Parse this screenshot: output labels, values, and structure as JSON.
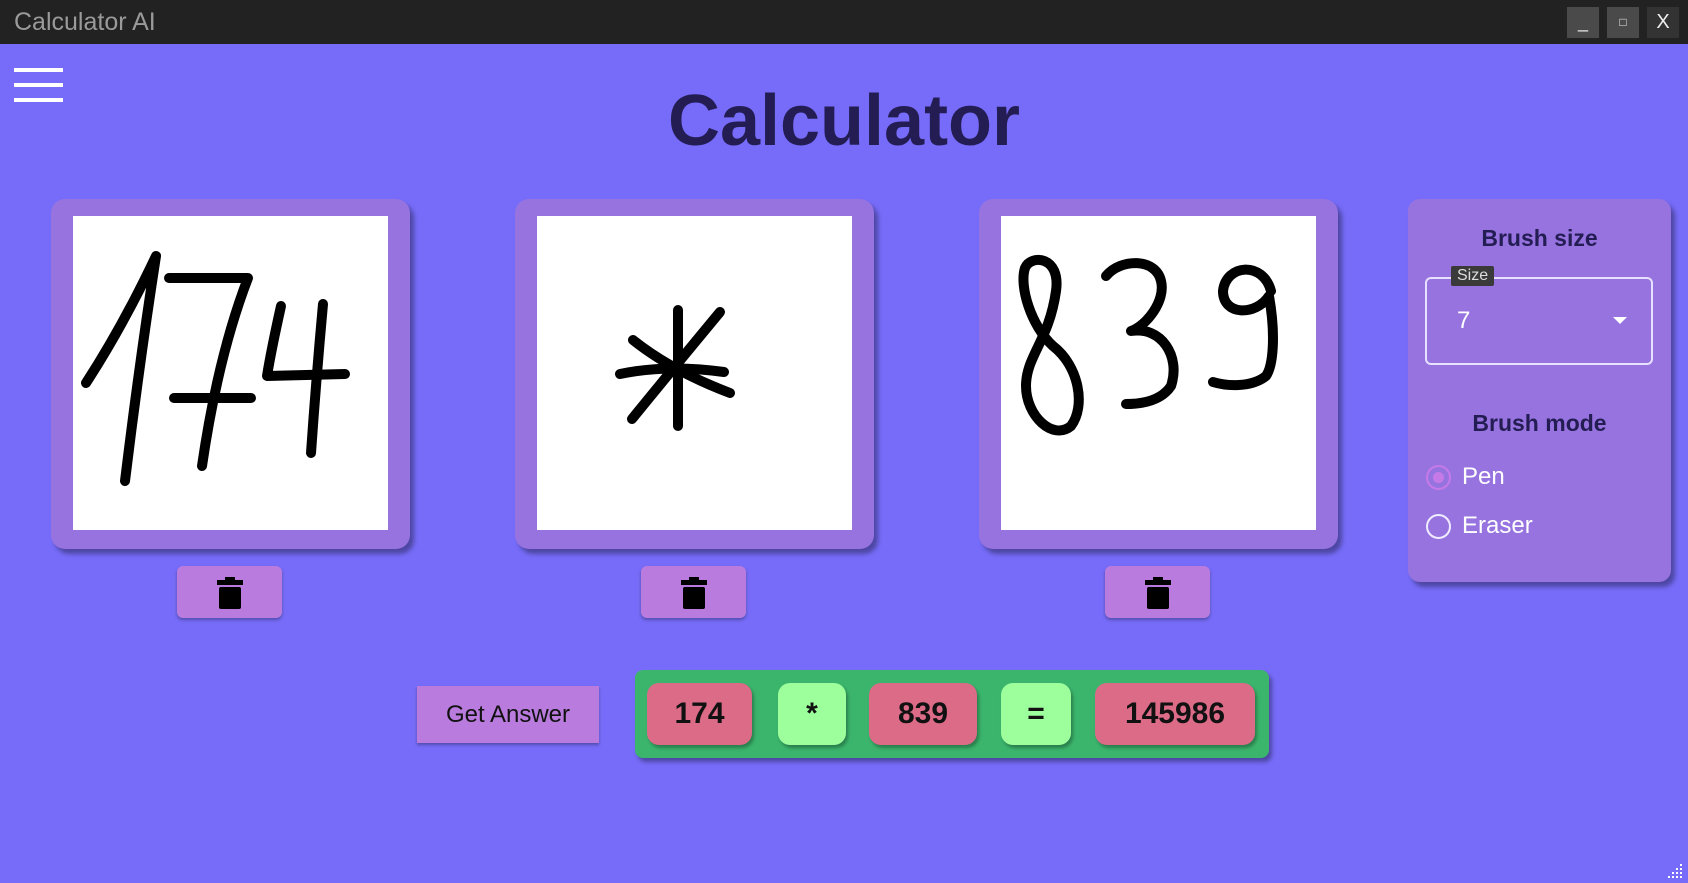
{
  "window": {
    "title": "Calculator AI",
    "minimize": "_",
    "maximize": "□",
    "close": "X"
  },
  "menu_icon": "hamburger-icon",
  "page_title": "Calculator",
  "canvases": [
    {
      "drawn_content": "174"
    },
    {
      "drawn_content": "*"
    },
    {
      "drawn_content": "839"
    }
  ],
  "clear_icon": "trash-icon",
  "brush": {
    "size_heading": "Brush size",
    "size_label": "Size",
    "size_value": "7",
    "mode_heading": "Brush mode",
    "modes": [
      {
        "label": "Pen",
        "checked": true
      },
      {
        "label": "Eraser",
        "checked": false
      }
    ]
  },
  "answer": {
    "button_label": "Get Answer",
    "operand1": "174",
    "operator": "*",
    "operand2": "839",
    "equals": "=",
    "result": "145986"
  },
  "colors": {
    "background": "#766cf9",
    "panel": "#9773e0",
    "button": "#b97bde",
    "result_bar": "#3bb56c",
    "number_chip": "#dc6b88",
    "operator_chip": "#9cff9c"
  }
}
